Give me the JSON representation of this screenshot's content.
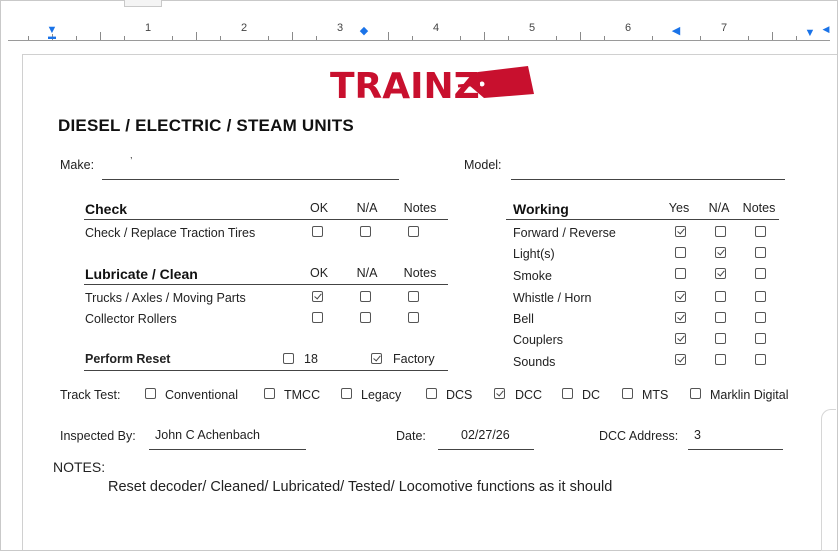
{
  "ruler": {
    "numbers": [
      "1",
      "2",
      "3",
      "4",
      "5",
      "6",
      "7"
    ]
  },
  "logo": {
    "text": "TRAINZ",
    "color": "#c8102e"
  },
  "form": {
    "title": "DIESEL / ELECTRIC / STEAM UNITS",
    "make_label": "Make:",
    "model_label": "Model:",
    "make_value": ",",
    "check": {
      "heading": "Check",
      "cols": [
        "OK",
        "N/A",
        "Notes"
      ],
      "items": [
        {
          "label": "Check / Replace Traction Tires"
        }
      ]
    },
    "lubricate": {
      "heading": "Lubricate / Clean",
      "cols": [
        "OK",
        "N/A",
        "Notes"
      ],
      "items": [
        {
          "label": "Trucks / Axles / Moving Parts"
        },
        {
          "label": "Collector Rollers"
        }
      ]
    },
    "reset": {
      "heading": "Perform Reset",
      "opt1": "18",
      "opt2": "Factory"
    },
    "working": {
      "heading": "Working",
      "cols": [
        "Yes",
        "N/A",
        "Notes"
      ],
      "items": [
        {
          "label": "Forward / Reverse"
        },
        {
          "label": "Light(s)"
        },
        {
          "label": "Smoke"
        },
        {
          "label": "Whistle / Horn"
        },
        {
          "label": "Bell"
        },
        {
          "label": "Couplers"
        },
        {
          "label": "Sounds"
        }
      ]
    },
    "track_test": {
      "label": "Track Test:",
      "options": [
        "Conventional",
        "TMCC",
        "Legacy",
        "DCS",
        "DCC",
        "DC",
        "MTS",
        "Marklin Digital"
      ]
    },
    "inspected_label": "Inspected By:",
    "inspected_value": "John C Achenbach",
    "date_label": "Date:",
    "date_value": "02/27/26",
    "dcc_label": "DCC Address:",
    "dcc_value": "3",
    "notes_label": "NOTES:",
    "notes_value": "Reset decoder/ Cleaned/ Lubricated/ Tested/  Locomotive functions as it should"
  }
}
